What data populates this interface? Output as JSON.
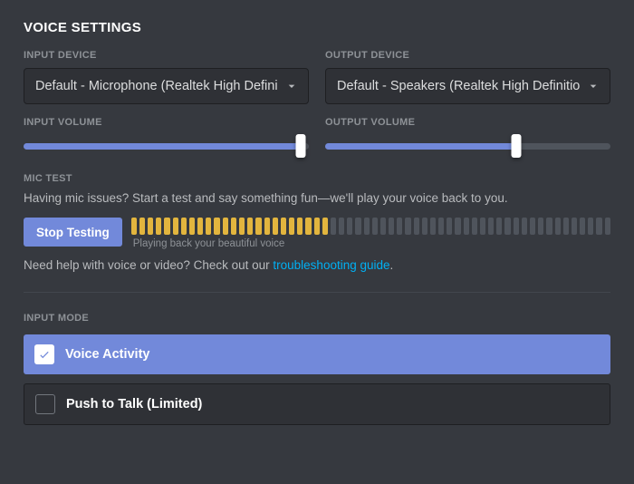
{
  "title": "VOICE SETTINGS",
  "input": {
    "label": "INPUT DEVICE",
    "value": "Default - Microphone (Realtek High Defini",
    "volumeLabel": "INPUT VOLUME",
    "volumePct": 97
  },
  "output": {
    "label": "OUTPUT DEVICE",
    "value": "Default - Speakers (Realtek High Definition",
    "volumeLabel": "OUTPUT VOLUME",
    "volumePct": 67
  },
  "micTest": {
    "label": "MIC TEST",
    "desc": "Having mic issues? Start a test and say something fun—we'll play your voice back to you.",
    "button": "Stop Testing",
    "playback": "Playing back your beautiful voice",
    "totalSegments": 58,
    "activeSegments": 24
  },
  "help": {
    "prefix": "Need help with voice or video? Check out our ",
    "linkText": "troubleshooting guide",
    "suffix": "."
  },
  "inputMode": {
    "label": "INPUT MODE",
    "options": [
      {
        "label": "Voice Activity",
        "selected": true
      },
      {
        "label": "Push to Talk (Limited)",
        "selected": false
      }
    ]
  }
}
